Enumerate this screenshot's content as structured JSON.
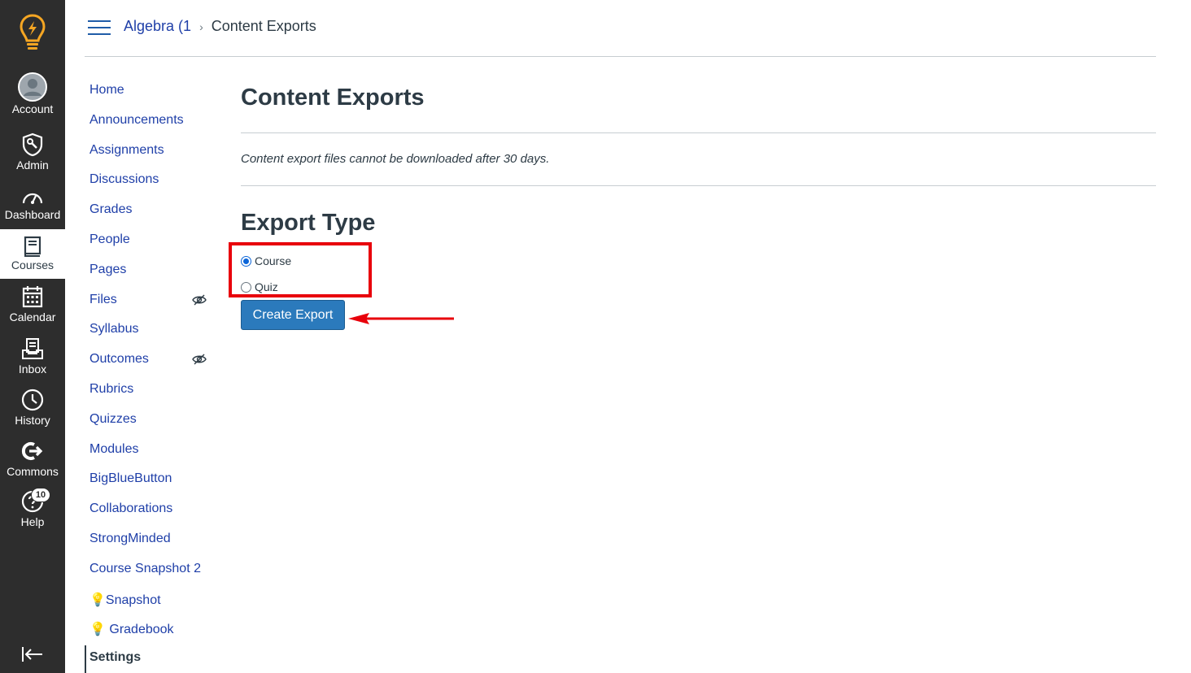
{
  "global_nav": {
    "items": [
      {
        "label": "Account",
        "icon": "avatar-icon"
      },
      {
        "label": "Admin",
        "icon": "shield-wrench-icon"
      },
      {
        "label": "Dashboard",
        "icon": "gauge-icon"
      },
      {
        "label": "Courses",
        "icon": "book-icon"
      },
      {
        "label": "Calendar",
        "icon": "calendar-icon"
      },
      {
        "label": "Inbox",
        "icon": "inbox-icon"
      },
      {
        "label": "History",
        "icon": "clock-icon"
      },
      {
        "label": "Commons",
        "icon": "commons-icon"
      },
      {
        "label": "Help",
        "icon": "help-icon",
        "badge": "10"
      }
    ],
    "active": "Courses"
  },
  "breadcrumb": {
    "course": "Algebra (1",
    "separator": "›",
    "current": "Content Exports"
  },
  "course_nav": {
    "items": [
      {
        "label": "Home"
      },
      {
        "label": "Announcements"
      },
      {
        "label": "Assignments"
      },
      {
        "label": "Discussions"
      },
      {
        "label": "Grades"
      },
      {
        "label": "People"
      },
      {
        "label": "Pages"
      },
      {
        "label": "Files",
        "hidden": true
      },
      {
        "label": "Syllabus"
      },
      {
        "label": "Outcomes",
        "hidden": true
      },
      {
        "label": "Rubrics"
      },
      {
        "label": "Quizzes"
      },
      {
        "label": "Modules"
      },
      {
        "label": "BigBlueButton"
      },
      {
        "label": "Collaborations"
      },
      {
        "label": "StrongMinded"
      },
      {
        "label": "Course Snapshot 2"
      },
      {
        "label": "Snapshot",
        "prefix": "💡"
      },
      {
        "label": "Gradebook",
        "prefix": "💡 "
      },
      {
        "label": "Settings",
        "active": true
      }
    ]
  },
  "main": {
    "title": "Content Exports",
    "notice": "Content export files cannot be downloaded after 30 days.",
    "export_type_title": "Export Type",
    "options": [
      {
        "label": "Course",
        "checked": true
      },
      {
        "label": "Quiz",
        "checked": false
      }
    ],
    "create_button": "Create Export"
  },
  "colors": {
    "global_nav_bg": "#2d2d2d",
    "link": "#1f3fa8",
    "button": "#2b7abc",
    "annotation": "#e8000b",
    "logo": "#f5a623"
  }
}
